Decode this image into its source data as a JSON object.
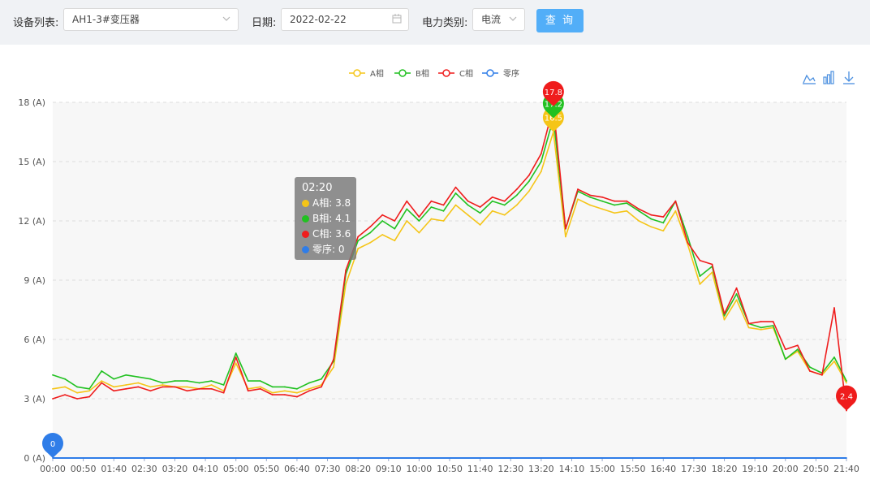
{
  "toolbar": {
    "device_label": "设备列表:",
    "device_value": "AH1-3#变压器",
    "date_label": "日期:",
    "date_value": "2022-02-22",
    "type_label": "电力类别:",
    "type_value": "电流",
    "query_label": "查 询"
  },
  "tools": [
    "line-chart-icon",
    "bar-chart-icon",
    "download-icon"
  ],
  "tooltip": {
    "title": "02:20",
    "rows": [
      "A相: 3.8",
      "B相: 4.1",
      "C相: 3.6",
      "零序: 0"
    ]
  },
  "chart_data": {
    "type": "line",
    "title": "",
    "xlabel": "",
    "ylabel": "",
    "ylim": [
      0,
      18
    ],
    "yticks": [
      0,
      3,
      6,
      9,
      12,
      15,
      18
    ],
    "ytick_labels": [
      "0 (A)",
      "3 (A)",
      "6 (A)",
      "9 (A)",
      "12 (A)",
      "15 (A)",
      "18 (A)"
    ],
    "x_tick_labels": [
      "00:00",
      "00:50",
      "01:40",
      "02:30",
      "03:20",
      "04:10",
      "05:00",
      "05:50",
      "06:40",
      "07:30",
      "08:20",
      "09:10",
      "10:00",
      "10:50",
      "11:40",
      "12:30",
      "13:20",
      "14:10",
      "15:00",
      "15:50",
      "16:40",
      "17:30",
      "18:20",
      "19:10",
      "20:00",
      "20:50",
      "21:40"
    ],
    "x": [
      "00:00",
      "00:20",
      "00:40",
      "01:00",
      "01:20",
      "01:40",
      "02:00",
      "02:20",
      "02:40",
      "03:00",
      "03:20",
      "03:40",
      "04:00",
      "04:20",
      "04:40",
      "05:00",
      "05:20",
      "05:40",
      "06:00",
      "06:20",
      "06:40",
      "07:00",
      "07:20",
      "07:40",
      "08:00",
      "08:20",
      "08:40",
      "09:00",
      "09:20",
      "09:40",
      "10:00",
      "10:20",
      "10:40",
      "11:00",
      "11:20",
      "11:40",
      "12:00",
      "12:20",
      "12:40",
      "13:00",
      "13:20",
      "13:40",
      "14:00",
      "14:20",
      "14:40",
      "15:00",
      "15:20",
      "15:40",
      "16:00",
      "16:20",
      "16:40",
      "17:00",
      "17:20",
      "17:40",
      "18:00",
      "18:20",
      "18:40",
      "19:00",
      "19:20",
      "19:40",
      "20:00",
      "20:20",
      "20:40",
      "21:00",
      "21:20",
      "21:40"
    ],
    "series": [
      {
        "name": "A相",
        "color": "#f5c518",
        "values": [
          3.5,
          3.6,
          3.3,
          3.4,
          3.9,
          3.6,
          3.7,
          3.8,
          3.6,
          3.7,
          3.6,
          3.6,
          3.5,
          3.7,
          3.4,
          4.8,
          3.5,
          3.6,
          3.3,
          3.4,
          3.3,
          3.5,
          3.7,
          4.6,
          8.8,
          10.6,
          10.9,
          11.3,
          11.0,
          12.0,
          11.4,
          12.1,
          12.0,
          12.8,
          12.3,
          11.8,
          12.5,
          12.3,
          12.8,
          13.5,
          14.5,
          16.5,
          11.2,
          13.1,
          12.8,
          12.6,
          12.4,
          12.5,
          12.0,
          11.7,
          11.5,
          12.5,
          10.8,
          8.8,
          9.4,
          7.0,
          8.0,
          6.6,
          6.5,
          6.6,
          5.0,
          5.4,
          4.4,
          4.2,
          4.9,
          3.8
        ]
      },
      {
        "name": "B相",
        "color": "#21c121",
        "values": [
          4.2,
          4.0,
          3.6,
          3.5,
          4.4,
          4.0,
          4.2,
          4.1,
          4.0,
          3.8,
          3.9,
          3.9,
          3.8,
          3.9,
          3.7,
          5.3,
          3.9,
          3.9,
          3.6,
          3.6,
          3.5,
          3.8,
          4.0,
          4.9,
          9.3,
          11.0,
          11.4,
          12.0,
          11.6,
          12.6,
          12.0,
          12.7,
          12.5,
          13.4,
          12.8,
          12.4,
          13.0,
          12.8,
          13.3,
          14.0,
          15.0,
          17.2,
          11.6,
          13.5,
          13.2,
          13.0,
          12.8,
          12.9,
          12.5,
          12.1,
          11.9,
          13.0,
          11.2,
          9.2,
          9.7,
          7.2,
          8.3,
          6.8,
          6.6,
          6.7,
          5.0,
          5.5,
          4.6,
          4.3,
          5.1,
          3.9
        ]
      },
      {
        "name": "C相",
        "color": "#ef1c1c",
        "values": [
          3.0,
          3.2,
          3.0,
          3.1,
          3.8,
          3.4,
          3.5,
          3.6,
          3.4,
          3.6,
          3.6,
          3.4,
          3.5,
          3.5,
          3.3,
          5.1,
          3.4,
          3.5,
          3.2,
          3.2,
          3.1,
          3.4,
          3.6,
          5.0,
          9.5,
          11.2,
          11.7,
          12.3,
          12.0,
          13.0,
          12.2,
          13.0,
          12.8,
          13.7,
          13.0,
          12.7,
          13.2,
          13.0,
          13.6,
          14.3,
          15.4,
          17.8,
          11.6,
          13.6,
          13.3,
          13.2,
          13.0,
          13.0,
          12.6,
          12.3,
          12.2,
          13.0,
          10.9,
          10.0,
          9.8,
          7.3,
          8.6,
          6.8,
          6.9,
          6.9,
          5.5,
          5.7,
          4.4,
          4.2,
          7.6,
          2.4
        ]
      },
      {
        "name": "零序",
        "color": "#2f7de8",
        "values": [
          0,
          0,
          0,
          0,
          0,
          0,
          0,
          0,
          0,
          0,
          0,
          0,
          0,
          0,
          0,
          0,
          0,
          0,
          0,
          0,
          0,
          0,
          0,
          0,
          0,
          0,
          0,
          0,
          0,
          0,
          0,
          0,
          0,
          0,
          0,
          0,
          0,
          0,
          0,
          0,
          0,
          0,
          0,
          0,
          0,
          0,
          0,
          0,
          0,
          0,
          0,
          0,
          0,
          0,
          0,
          0,
          0,
          0,
          0,
          0,
          0,
          0,
          0,
          0,
          0,
          0
        ]
      }
    ],
    "markers": [
      {
        "series": "A相",
        "x": "13:40",
        "value": 16.5,
        "label": "16.5"
      },
      {
        "series": "B相",
        "x": "13:40",
        "value": 17.2,
        "label": "17.2"
      },
      {
        "series": "C相",
        "x": "13:40",
        "value": 17.8,
        "label": "17.8"
      },
      {
        "series": "C相",
        "x": "21:40",
        "value": 2.4,
        "label": "2.4"
      },
      {
        "series": "零序",
        "x": "00:00",
        "value": 0,
        "label": "0"
      }
    ],
    "legend_position": "top-center",
    "grid": true
  }
}
